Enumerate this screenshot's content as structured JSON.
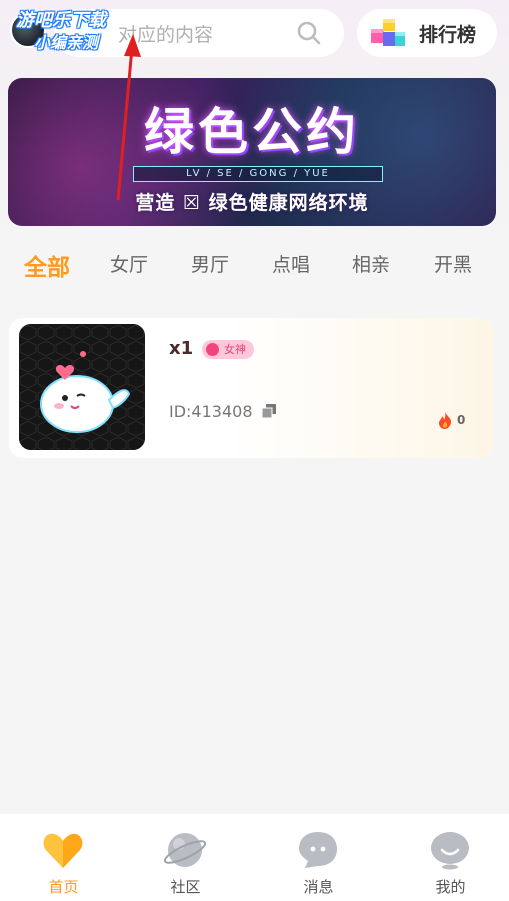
{
  "search": {
    "placeholder": "对应的内容"
  },
  "rank_button": {
    "label": "排行榜"
  },
  "watermark": {
    "line1": "游吧乐下载",
    "line2": "小编亲测"
  },
  "banner": {
    "title": "绿色公约",
    "subtitle": "LV / SE / GONG / YUE",
    "slogan": "营造 ☒ 绿色健康网络环境"
  },
  "tabs": [
    {
      "label": "全部",
      "active": true
    },
    {
      "label": "女厅",
      "active": false
    },
    {
      "label": "男厅",
      "active": false
    },
    {
      "label": "点唱",
      "active": false
    },
    {
      "label": "相亲",
      "active": false
    },
    {
      "label": "开黑",
      "active": false
    }
  ],
  "rooms": [
    {
      "title": "x1",
      "tag": "女神",
      "id": "ID:413408",
      "heat": "0"
    }
  ],
  "nav": [
    {
      "label": "首页",
      "icon": "heart-icon",
      "active": true
    },
    {
      "label": "社区",
      "icon": "planet-icon",
      "active": false
    },
    {
      "label": "消息",
      "icon": "chat-icon",
      "active": false
    },
    {
      "label": "我的",
      "icon": "profile-icon",
      "active": false
    }
  ],
  "colors": {
    "accent": "#ff9a1f",
    "tag_bg": "#ffc7d9",
    "tag_text": "#e0467d",
    "arrow": "#e02020"
  }
}
